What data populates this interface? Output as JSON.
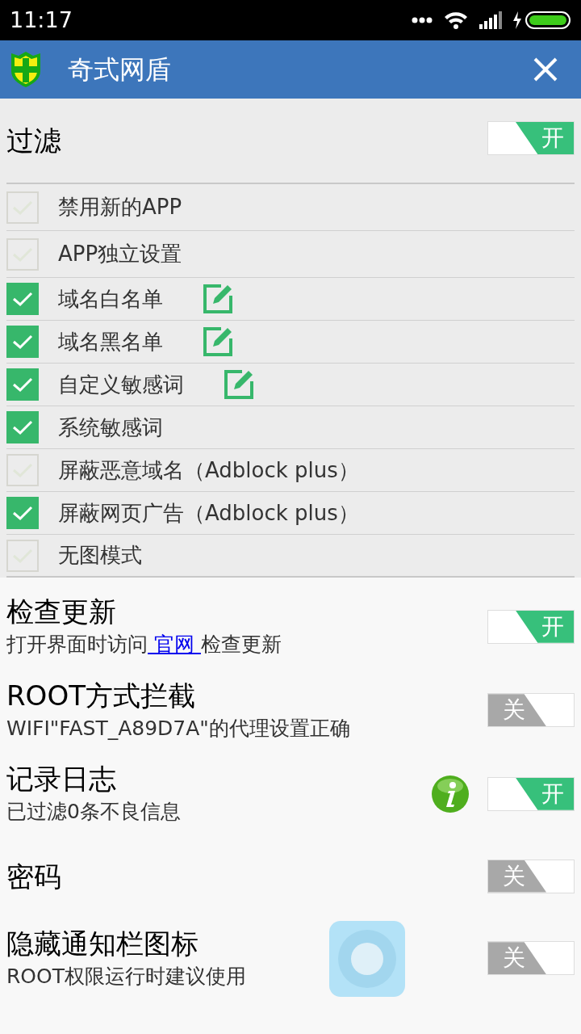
{
  "status_bar": {
    "time": "11:17"
  },
  "header": {
    "title": "奇式网盾"
  },
  "filter": {
    "title": "过滤",
    "toggle": {
      "on": true,
      "label": "开"
    }
  },
  "options": [
    {
      "label": "禁用新的APP",
      "checked": false,
      "editable": false
    },
    {
      "label": "APP独立设置",
      "checked": false,
      "editable": false
    },
    {
      "label": "域名白名单",
      "checked": true,
      "editable": true
    },
    {
      "label": "域名黑名单",
      "checked": true,
      "editable": true
    },
    {
      "label": "自定义敏感词",
      "checked": true,
      "editable": true
    },
    {
      "label": "系统敏感词",
      "checked": true,
      "editable": false
    },
    {
      "label": "屏蔽恶意域名（Adblock plus）",
      "checked": false,
      "editable": false
    },
    {
      "label": "屏蔽网页广告（Adblock plus）",
      "checked": true,
      "editable": false
    },
    {
      "label": "无图模式",
      "checked": false,
      "editable": false
    }
  ],
  "settings": [
    {
      "title": "检查更新",
      "subtitle": {
        "before": "打开界面时访问",
        "link": " 官网 ",
        "after": "检查更新"
      },
      "info": false,
      "toggle": {
        "on": true,
        "label": "开"
      }
    },
    {
      "title": "ROOT方式拦截",
      "subtitle": {
        "before": "WIFI\"FAST_A89D7A\"的代理设置正确"
      },
      "info": false,
      "toggle": {
        "on": false,
        "label": "关"
      }
    },
    {
      "title": "记录日志",
      "subtitle": {
        "before": "已过滤0条不良信息"
      },
      "info": true,
      "toggle": {
        "on": true,
        "label": "开"
      }
    },
    {
      "title": "密码",
      "info": false,
      "toggle": {
        "on": false,
        "label": "关"
      }
    },
    {
      "title": "隐藏通知栏图标",
      "subtitle": {
        "before": "ROOT权限运行时建议使用"
      },
      "info": false,
      "toggle": {
        "on": false,
        "label": "关"
      }
    }
  ]
}
